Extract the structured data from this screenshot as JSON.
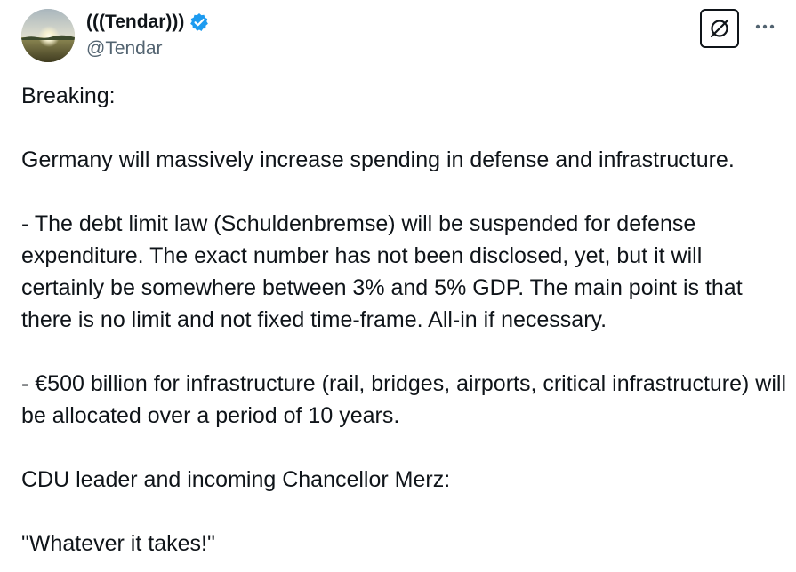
{
  "author": {
    "display_name": "(((Tendar)))",
    "handle": "@Tendar",
    "verified": true,
    "avatar_icon": "sunset-field-avatar",
    "verified_color": "#1d9bf0"
  },
  "actions": {
    "grok_icon": "grok-icon",
    "more_icon": "more-dots-icon"
  },
  "tweet": {
    "paragraphs": [
      "Breaking:",
      "Germany will massively increase spending in defense and infrastructure.",
      "- The debt limit law (Schuldenbremse) will be suspended for defense expenditure. The exact number has not been disclosed, yet, but it will certainly be somewhere between 3% and 5% GDP. The main point is that there is no limit and not fixed time-frame. All-in if necessary.",
      "- €500 billion for infrastructure (rail, bridges, airports, critical infrastructure) will be allocated over a period of 10 years.",
      "CDU leader and incoming Chancellor Merz:",
      "\"Whatever it takes!\""
    ]
  },
  "colors": {
    "text": "#0f1419",
    "secondary": "#536471"
  }
}
